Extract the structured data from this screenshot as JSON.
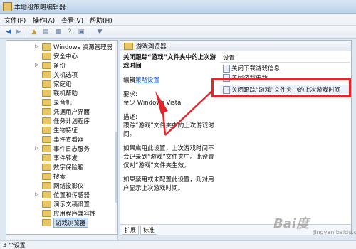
{
  "window": {
    "title": "本地组策略编辑器"
  },
  "menu": [
    "文件(F)",
    "操作(A)",
    "查看(V)",
    "帮助(H)"
  ],
  "tree": {
    "items": [
      {
        "label": "Windows 资源管理器",
        "expand": "▷"
      },
      {
        "label": "安全中心",
        "expand": ""
      },
      {
        "label": "备份",
        "expand": "▷"
      },
      {
        "label": "关机选项",
        "expand": ""
      },
      {
        "label": "家庭组",
        "expand": ""
      },
      {
        "label": "联机帮助",
        "expand": ""
      },
      {
        "label": "录音机",
        "expand": ""
      },
      {
        "label": "凭据用户界面",
        "expand": ""
      },
      {
        "label": "任务计划程序",
        "expand": ""
      },
      {
        "label": "生物特征",
        "expand": ""
      },
      {
        "label": "事件查看器",
        "expand": ""
      },
      {
        "label": "事件日志服务",
        "expand": "▷"
      },
      {
        "label": "事件转发",
        "expand": ""
      },
      {
        "label": "数字保险箱",
        "expand": ""
      },
      {
        "label": "搜索",
        "expand": ""
      },
      {
        "label": "网络投影仪",
        "expand": ""
      },
      {
        "label": "位置和传感器",
        "expand": "▷"
      },
      {
        "label": "演示文稿设置",
        "expand": ""
      },
      {
        "label": "应用程序兼容性",
        "expand": ""
      },
      {
        "label": "游戏浏览器",
        "expand": ""
      }
    ]
  },
  "right": {
    "header": "游戏浏览器",
    "desc_title": "关闭跟踪“游戏”文件夹中的上次游戏时间",
    "edit_prefix": "编辑",
    "edit_link": "策略设置",
    "req_label": "要求:",
    "req_value": "至少 Windows Vista",
    "desc_label": "描述:",
    "desc_text": "跟踪“游戏”文件夹中的上次游戏时间。",
    "desc_enabled": "如果启用此设置，上次游戏时间不会记录到“游戏”文件夹中。此设置仅对“游戏”文件夹生效。",
    "desc_disabled": "如果禁用或未配置此设置，则对用户显示上次游戏时间。",
    "col_header": "设置",
    "items": [
      "关闭下载游戏信息",
      "关闭游戏更新",
      "关闭跟踪“游戏”文件夹中的上次游戏时间"
    ],
    "tabs": [
      "扩展",
      "标准"
    ]
  },
  "status": {
    "text": "3 个设置"
  },
  "watermark": {
    "logo": "Bai度",
    "sub": "jingyan.baidu.com"
  },
  "colors": {
    "highlight": "#e3262b",
    "link": "#1a55c9"
  }
}
